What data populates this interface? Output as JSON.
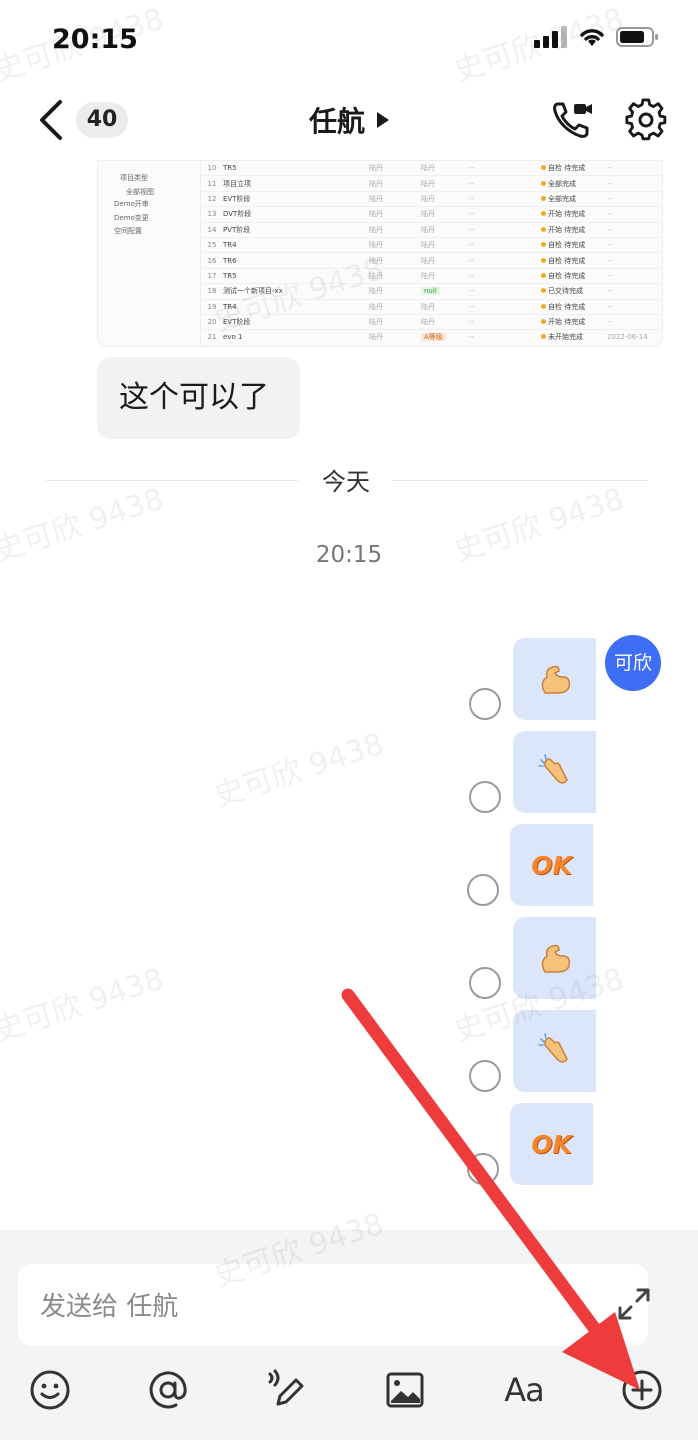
{
  "status": {
    "time": "20:15"
  },
  "header": {
    "back_count": "40",
    "title": "任航"
  },
  "shared_table": {
    "sidebar": [
      "项目类型",
      "全部视图",
      "Demo开审",
      "Demo变更",
      "空间配置"
    ],
    "rows": [
      {
        "n": "10",
        "name": "TR5",
        "a": "陆丹",
        "b": "陆丹",
        "c": "--",
        "st": "自检 待完成",
        "dt": "--"
      },
      {
        "n": "11",
        "name": "项目立项",
        "a": "陆丹",
        "b": "陆丹",
        "c": "--",
        "st": "全部完成",
        "dt": "--"
      },
      {
        "n": "12",
        "name": "EVT阶段",
        "a": "陆丹",
        "b": "陆丹",
        "c": "--",
        "st": "全部完成",
        "dt": "--"
      },
      {
        "n": "13",
        "name": "DVT阶段",
        "a": "陆丹",
        "b": "陆丹",
        "c": "--",
        "st": "开始 待完成",
        "dt": "--"
      },
      {
        "n": "14",
        "name": "PVT阶段",
        "a": "陆丹",
        "b": "陆丹",
        "c": "--",
        "st": "开始 待完成",
        "dt": "--"
      },
      {
        "n": "15",
        "name": "TR4",
        "a": "陆丹",
        "b": "陆丹",
        "c": "--",
        "st": "自检 待完成",
        "dt": "--"
      },
      {
        "n": "16",
        "name": "TR6",
        "a": "陆丹",
        "b": "陆丹",
        "c": "--",
        "st": "自检 待完成",
        "dt": "--"
      },
      {
        "n": "17",
        "name": "TR5",
        "a": "陆丹",
        "b": "陆丹",
        "c": "--",
        "st": "自检 待完成",
        "dt": "--"
      },
      {
        "n": "18",
        "name": "测试一个新项目-xx",
        "a": "陆丹",
        "b": "null",
        "c": "--",
        "st": "已交待完成",
        "dt": "--"
      },
      {
        "n": "19",
        "name": "TR4",
        "a": "陆丹",
        "b": "陆丹",
        "c": "--",
        "st": "自检 待完成",
        "dt": "--"
      },
      {
        "n": "20",
        "name": "EVT阶段",
        "a": "陆丹",
        "b": "陆丹",
        "c": "--",
        "st": "开始 待完成",
        "dt": "--"
      },
      {
        "n": "21",
        "name": "evo 1",
        "a": "陆丹",
        "b": "A等级",
        "c": "--",
        "st": "未开始完成",
        "dt": "2022-06-14"
      }
    ]
  },
  "messages": {
    "incoming_text": "这个可以了",
    "day_divider": "今天",
    "timestamp": "20:15",
    "sender_avatar": "可欣",
    "ok_text": "OK",
    "stickers": [
      "muscle",
      "clap",
      "ok",
      "muscle",
      "clap",
      "ok"
    ]
  },
  "composer": {
    "placeholder": "发送给 任航"
  },
  "toolbar": {
    "font_label": "Aa"
  },
  "watermark": "史可欣 9438",
  "colors": {
    "accent": "#3d6ef5",
    "sticker_bg": "#dce6fb",
    "arrow": "#ee3b3b"
  }
}
